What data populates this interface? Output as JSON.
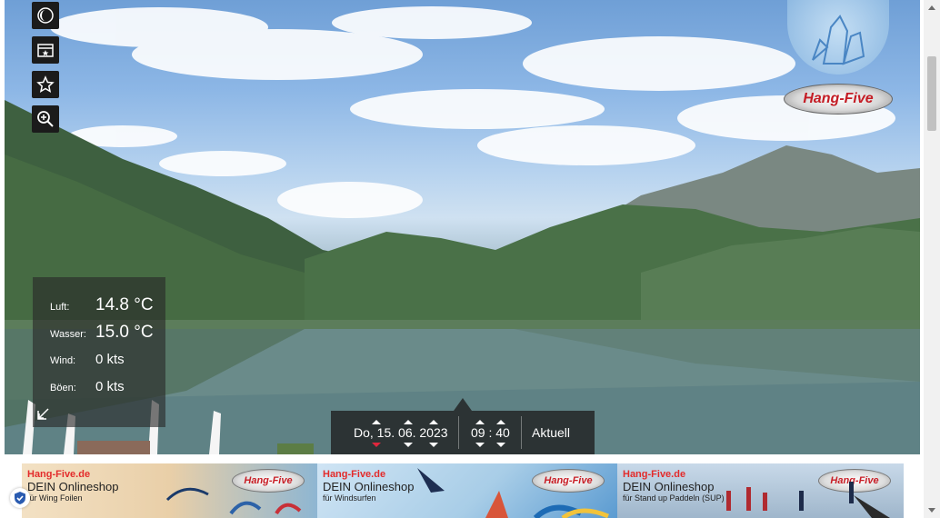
{
  "weather": {
    "air_label": "Luft:",
    "air_value": "14.8 °C",
    "water_label": "Wasser:",
    "water_value": "15.0 °C",
    "wind_label": "Wind:",
    "wind_value": "0 kts",
    "gust_label": "Böen:",
    "gust_value": "0 kts"
  },
  "timebar": {
    "date": "Do, 15. 06. 2023",
    "hour": "09",
    "minute": "40",
    "now_label": "Aktuell"
  },
  "logo": {
    "brand": "Hang-Five"
  },
  "banners": [
    {
      "brand": "Hang-Five.de",
      "line1": "DEIN Onlineshop",
      "line2": "für Wing Foilen",
      "logo": "Hang-Five"
    },
    {
      "brand": "Hang-Five.de",
      "line1": "DEIN Onlineshop",
      "line2": "für Windsurfen",
      "logo": "Hang-Five"
    },
    {
      "brand": "Hang-Five.de",
      "line1": "DEIN Onlineshop",
      "line2": "für Stand up Paddeln (SUP)",
      "logo": "Hang-Five"
    }
  ],
  "icons": [
    "night-mode-icon",
    "gallery-icon",
    "favorite-icon",
    "zoom-icon",
    "expand-icon",
    "privacy-icon"
  ],
  "colors": {
    "panel": "#282828",
    "accent_red": "#e0263c",
    "brand_red": "#e32b2b"
  }
}
